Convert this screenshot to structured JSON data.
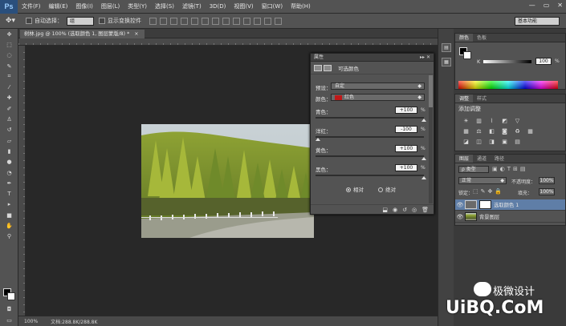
{
  "app": {
    "logo": "Ps",
    "window_controls": [
      "—",
      "▭",
      "✕"
    ]
  },
  "menu": [
    "文件(F)",
    "编辑(E)",
    "图像(I)",
    "图层(L)",
    "类型(Y)",
    "选择(S)",
    "滤镜(T)",
    "3D(D)",
    "视图(V)",
    "窗口(W)",
    "帮助(H)"
  ],
  "options_bar": {
    "auto_select_label": "自动选择：",
    "auto_select_value": "组",
    "show_transform_label": "显示变换控件",
    "workspace_value": "基本功能"
  },
  "document": {
    "tab_title": "树林.jpg @ 100% (选取颜色 1, 图层蒙版/8) *",
    "status_zoom": "100%",
    "status_doc": "文档:288.8K/288.8K"
  },
  "properties": {
    "title": "属性",
    "type_label": "可选颜色",
    "preset_label": "预设：",
    "preset_value": "自定",
    "colors_label": "颜色：",
    "colors_value": "红色",
    "sliders": [
      {
        "label": "青色：",
        "value": "+100",
        "unit": "%",
        "level": 1.0
      },
      {
        "label": "洋红：",
        "value": "-100",
        "unit": "%",
        "level": 0.0
      },
      {
        "label": "黄色：",
        "value": "+100",
        "unit": "%",
        "level": 1.0
      },
      {
        "label": "黑色：",
        "value": "+100",
        "unit": "%",
        "level": 1.0
      }
    ],
    "mode_relative": "相对",
    "mode_absolute": "绝对"
  },
  "color_panel": {
    "tabs": [
      "颜色",
      "色板"
    ],
    "k_label": "K",
    "k_value": "100",
    "k_unit": "%"
  },
  "adjustments_panel": {
    "tabs": [
      "调整",
      "样式"
    ],
    "title": "添加调整"
  },
  "layers_panel": {
    "tabs": [
      "图层",
      "通道",
      "路径"
    ],
    "filter_label": "ρ 类型",
    "blend_mode": "正常",
    "opacity_label": "不透明度：",
    "opacity_value": "100%",
    "lock_label": "锁定：",
    "fill_label": "填充：",
    "fill_value": "100%",
    "layers": [
      {
        "name": "选取颜色 1",
        "selected": true
      },
      {
        "name": "背景图层",
        "selected": false
      }
    ]
  },
  "watermark": {
    "brand": "极微设计",
    "url": "UiBQ.CoM"
  }
}
